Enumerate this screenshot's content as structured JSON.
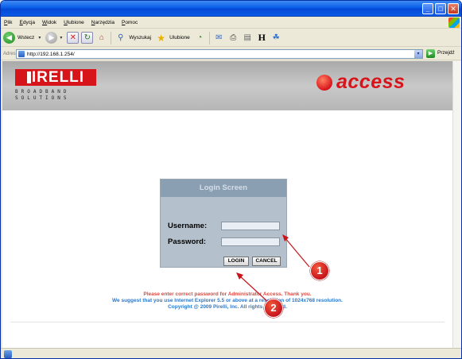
{
  "window": {
    "min_glyph": "_",
    "max_glyph": "□",
    "close_glyph": "✕"
  },
  "menu": [
    "Plik",
    "Edycja",
    "Widok",
    "Ulubione",
    "Narzędzia",
    "Pomoc"
  ],
  "toolbar": {
    "back_label": "Wstecz",
    "search_label": "Wyszukaj",
    "favorites_label": "Ulubione"
  },
  "address": {
    "label": "Adres",
    "url": "http://192.168.1.254/",
    "go_label": "Przejdź"
  },
  "banner": {
    "brand": "IRELLI",
    "brand_sub_line1": "BROADBAND",
    "brand_sub_line2": "SOLUTIONS",
    "access_text": "access"
  },
  "login": {
    "title": "Login Screen",
    "username_label": "Username:",
    "password_label": "Password:",
    "username_value": "",
    "password_value": "",
    "login_button": "LOGIN",
    "cancel_button": "CANCEL"
  },
  "notices": {
    "red": "Please enter correct password for Administrator Access. Thank you.",
    "blue": "We suggest that you use Internet Explorer 5.5 or above at a resolution of 1024x768 resolution.",
    "copyright": "Copyright @ 2009 Pirelli, Inc. All rights reserved."
  },
  "callouts": {
    "one": "1",
    "two": "2"
  },
  "colors": {
    "brand_red": "#d8141b",
    "panel_bg": "#b4c0cc",
    "panel_title": "#8b9fb3",
    "notice_red": "#e0463c",
    "notice_blue": "#2c78c8"
  }
}
